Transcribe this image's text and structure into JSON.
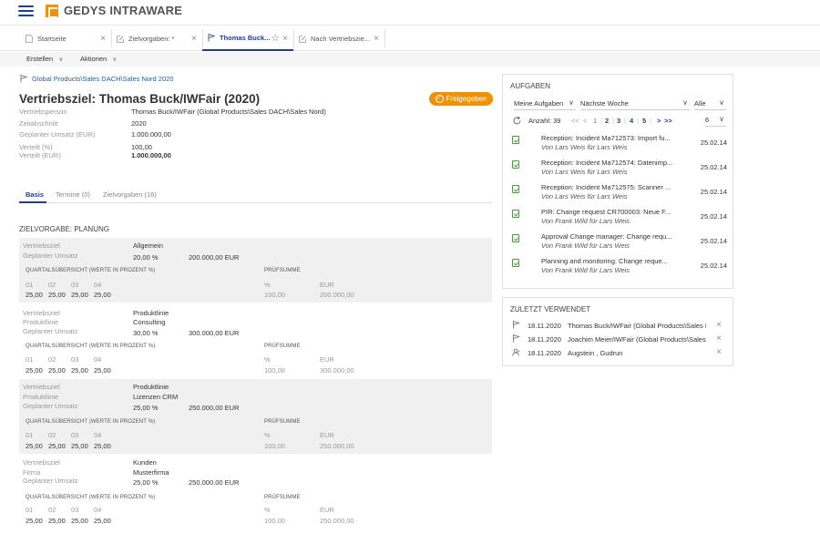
{
  "app": {
    "name": "GEDYS INTRAWARE"
  },
  "tabs": [
    {
      "label": "Startseite"
    },
    {
      "label": "Zielvorgaben: *"
    },
    {
      "label": "Thomas Buck..."
    },
    {
      "label": "Nach Vertriebszie..."
    }
  ],
  "actions": {
    "create": "Erstellen",
    "actions": "Aktionen"
  },
  "breadcrumb": "Global Products\\Sales DACH\\Sales Nord 2020",
  "title": "Vertriebsziel: Thomas Buck/IWFair (2020)",
  "release_button": "Freigegeben",
  "fields": [
    {
      "label": "Vertriebsperson",
      "value": "Thomas Buck/IWFair (Global Products\\Sales DACH\\Sales Nord)"
    },
    {
      "label": "Zeitabschnitt",
      "value": "2020"
    },
    {
      "label": "Geplanter Umsatz (EUR)",
      "value": "1.000.000,00"
    },
    {
      "label": "Verteilt (%)",
      "value": "100,00"
    },
    {
      "label": "Verteilt (EUR)",
      "value": "1.000.000,00"
    }
  ],
  "subtabs": [
    "Basis",
    "Termine (0)",
    "Zielvorgaben (16)"
  ],
  "section_title": "ZIELVORGABE: PLANUNG",
  "common": {
    "quarter_header": "QUARTALSÜBERSICHT (WERTE IN PROZENT %)",
    "check_header": "PRÜFSUMME",
    "q1": "01",
    "q2": "02",
    "q3": "03",
    "q4": "04",
    "pct": "%",
    "eur": "EUR",
    "l_vertriebsziel": "Vertriebsziel",
    "l_produktlinie": "Produktlinie",
    "l_firma": "Firma",
    "l_umsatz": "Geplanter Umsatz"
  },
  "blocks": [
    {
      "v1": "Allgemein",
      "v2": "",
      "pct": "20,00 %",
      "eur": "200.000,00 EUR",
      "q": [
        "25,00",
        "25,00",
        "25,00",
        "25,00"
      ],
      "sum_pct": "100,00",
      "sum_eur": "200.000,00"
    },
    {
      "v1": "Produktlinie",
      "v2": "Consulting",
      "pct": "30,00 %",
      "eur": "300.000,00 EUR",
      "q": [
        "25,00",
        "25,00",
        "25,00",
        "25,00"
      ],
      "sum_pct": "100,00",
      "sum_eur": "300.000,00"
    },
    {
      "v1": "Produktlinie",
      "v2": "Lizenzen CRM",
      "pct": "25,00 %",
      "eur": "250.000,00 EUR",
      "q": [
        "25,00",
        "25,00",
        "25,00",
        "25,00"
      ],
      "sum_pct": "100,00",
      "sum_eur": "250.000,00"
    },
    {
      "v1": "Kunden",
      "v2": "Musterfirma",
      "pct": "25,00 %",
      "eur": "250.000,00 EUR",
      "q": [
        "25,00",
        "25,00",
        "25,00",
        "25,00"
      ],
      "sum_pct": "100,00",
      "sum_eur": "250.000,00"
    }
  ],
  "aufgaben": {
    "title": "AUFGABEN",
    "filter1": "Meine Aufgaben",
    "filter2": "Nächste Woche",
    "filter3": "Alle",
    "count": "Anzahl: 39",
    "pages": {
      "first": "<<",
      "prev": "<",
      "p1": "1",
      "p2": "2",
      "p3": "3",
      "p4": "4",
      "p5": "5",
      "next": ">",
      "last": ">>"
    },
    "page_size": "6",
    "items": [
      {
        "title": "Reception: Incident Ma712573: Import fu...",
        "sub": "Von Lars Weis für Lars Weis",
        "date": "25.02.14"
      },
      {
        "title": "Reception: Incident Ma712574: Datenimp...",
        "sub": "Von Lars Weis für Lars Weis",
        "date": "25.02.14"
      },
      {
        "title": "Reception: Incident Ma712575: Scanner ...",
        "sub": "Von Lars Weis für Lars Weis",
        "date": "25.02.14"
      },
      {
        "title": "PIR: Change request CR700003: Neue F...",
        "sub": "Von Frank Wild für Lars Weis",
        "date": "25.02.14"
      },
      {
        "title": "Approval Change manager: Change requ...",
        "sub": "Von Frank Wild für Lars Weis",
        "date": "25.02.14"
      },
      {
        "title": "Planning and monitoring: Change reque...",
        "sub": "Von Frank Wild für Lars Weis",
        "date": "25.02.14"
      }
    ]
  },
  "zuletzt": {
    "title": "ZULETZT VERWENDET",
    "items": [
      {
        "date": "18.11.2020",
        "text": "Thomas Buck/IWFair (Global Products\\Sales DACH\\Sales Nord)",
        "icon": "flag-icon"
      },
      {
        "date": "18.11.2020",
        "text": "Joachim Meier/IWFair (Global Products\\Sales DACH\\Sales Nord)",
        "icon": "flag-icon"
      },
      {
        "date": "18.11.2020",
        "text": "Augstein , Gudrun",
        "icon": "person-icon"
      }
    ]
  },
  "colors": {
    "accent": "#1f3f8a",
    "orange": "#f29100"
  }
}
